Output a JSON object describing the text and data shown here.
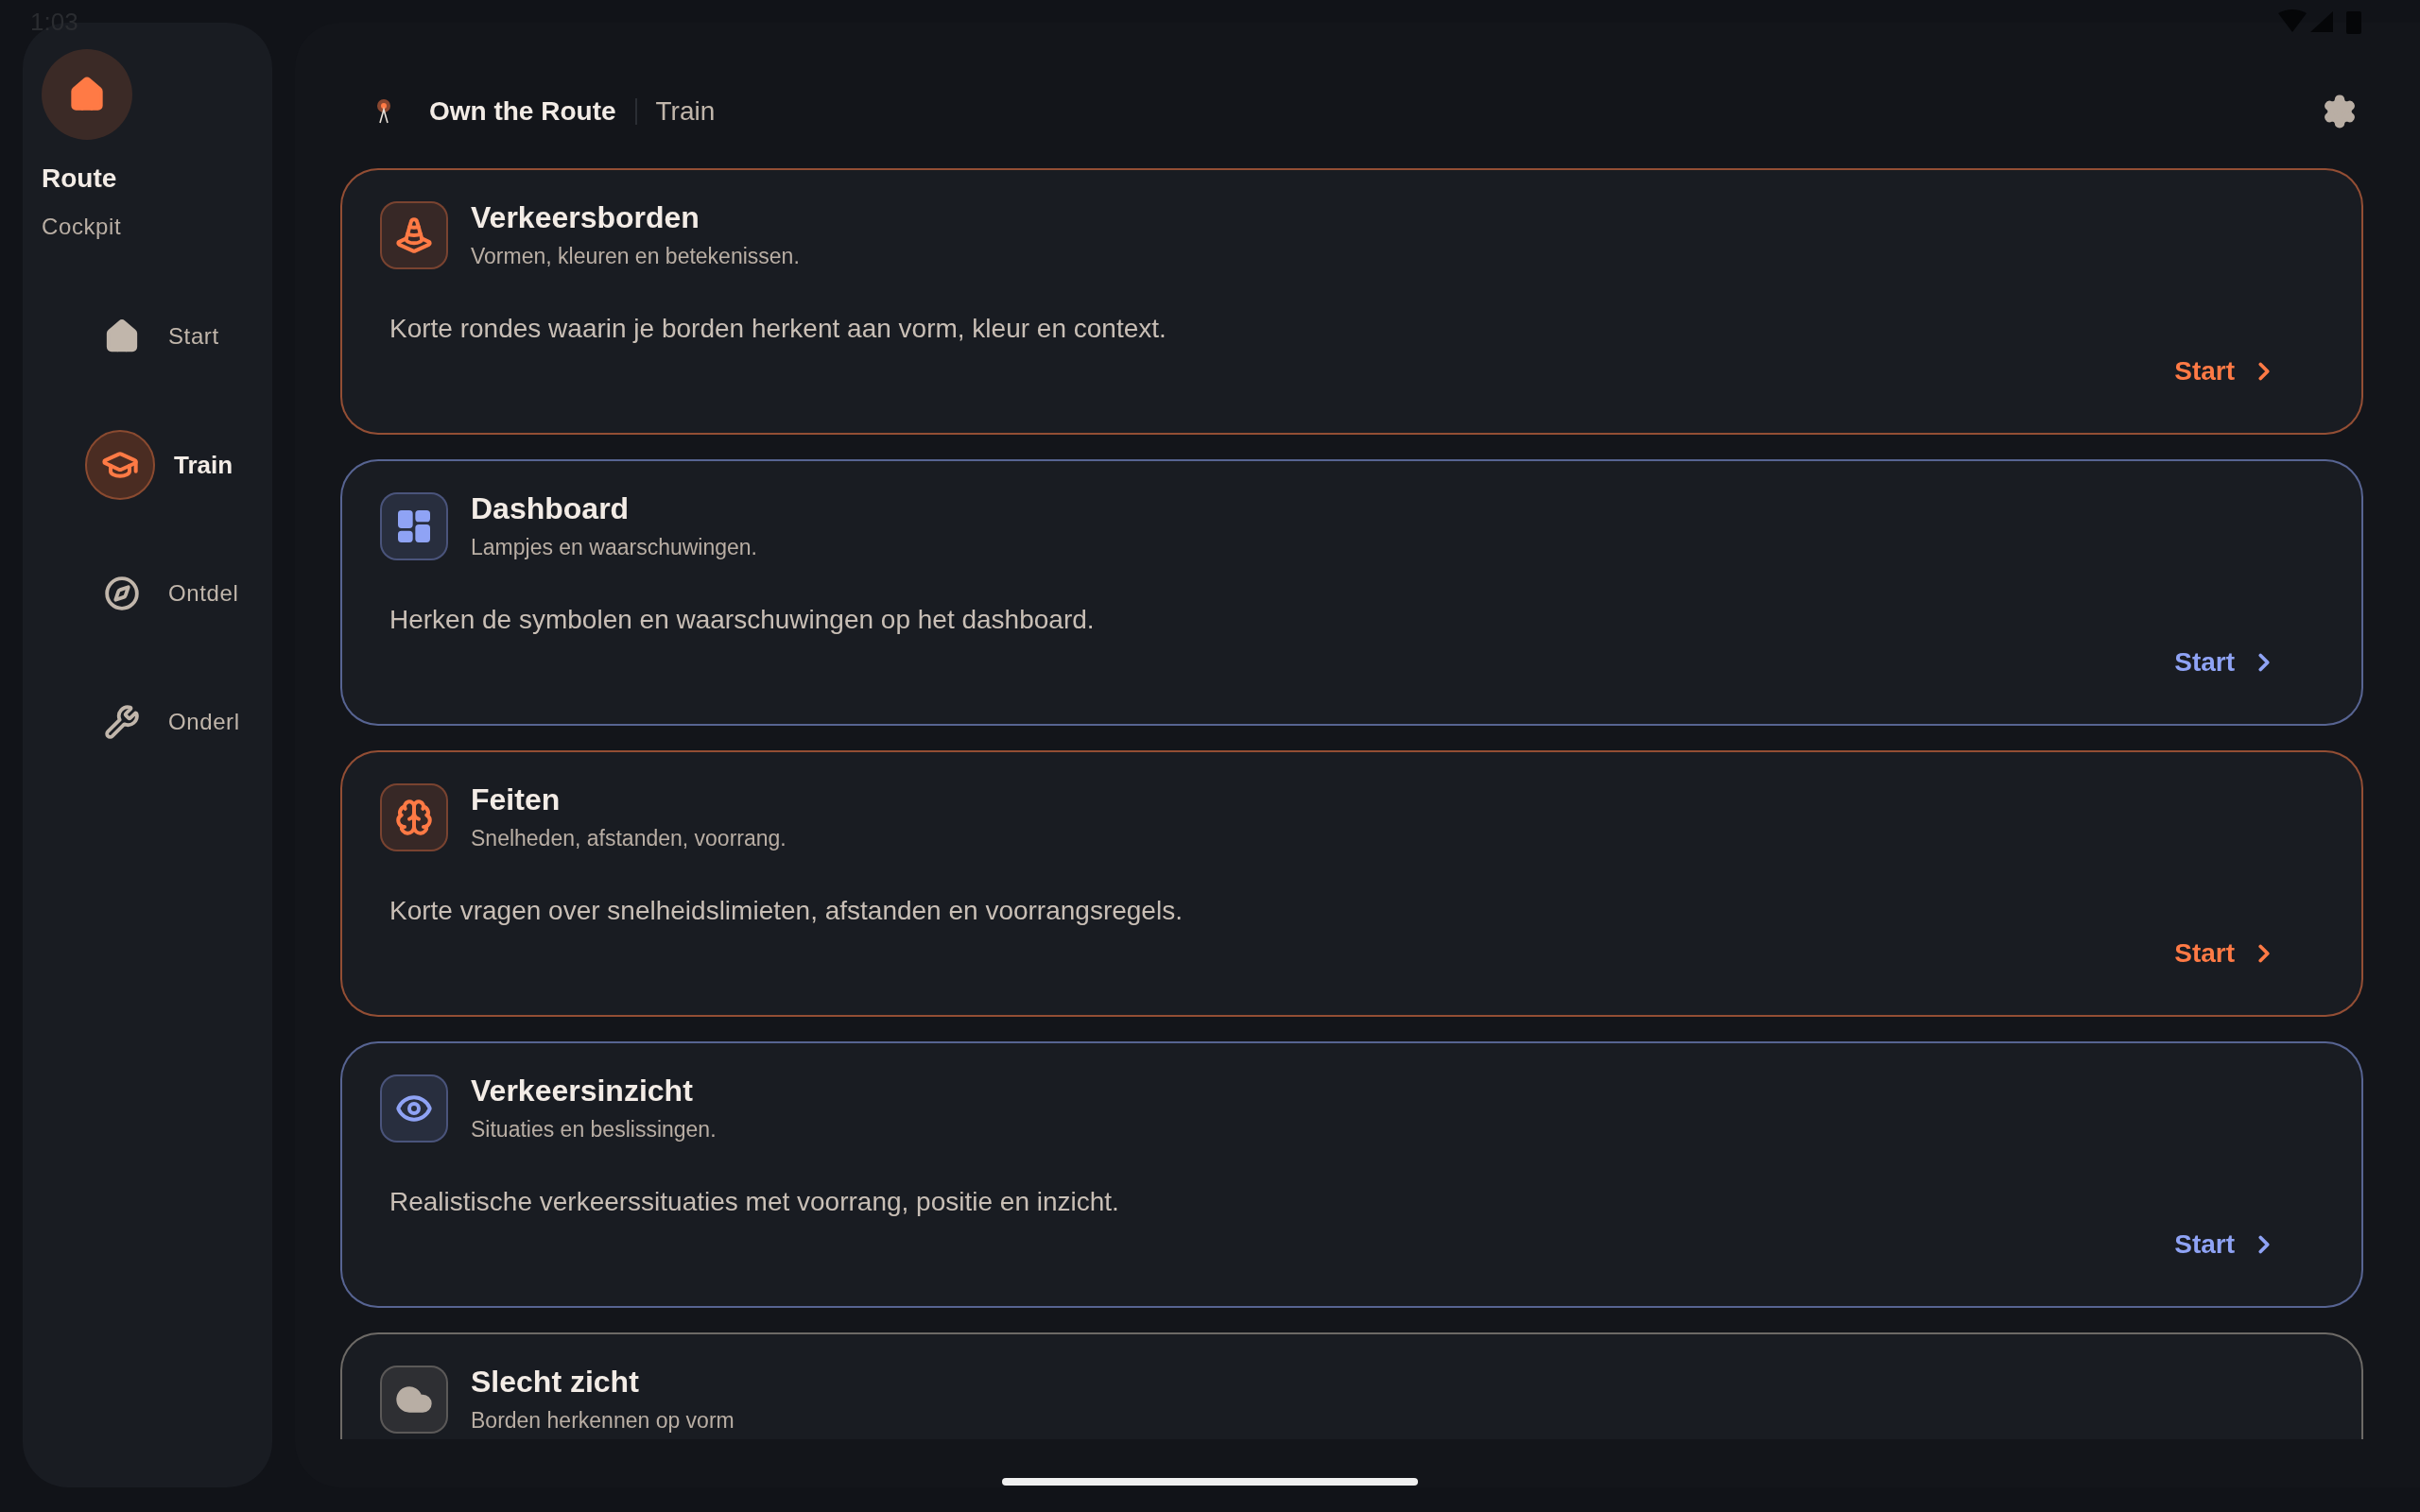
{
  "status_bar": {
    "time": "1:03"
  },
  "sidebar": {
    "title": "Route",
    "subtitle": "Cockpit",
    "items": [
      {
        "label": "Start",
        "selected": false
      },
      {
        "label": "Train",
        "selected": true
      },
      {
        "label": "Ontdel",
        "selected": false
      },
      {
        "label": "Onderl",
        "selected": false
      }
    ]
  },
  "header": {
    "app_name": "Own the Route",
    "section": "Train"
  },
  "cards": [
    {
      "title": "Verkeersborden",
      "subtitle": "Vormen, kleuren en betekenissen.",
      "description": "Korte rondes waarin je borden herkent aan vorm, kleur en context.",
      "action": "Start",
      "color": "#ff7a45"
    },
    {
      "title": "Dashboard",
      "subtitle": "Lampjes en waarschuwingen.",
      "description": "Herken de symbolen en waarschuwingen op het dashboard.",
      "action": "Start",
      "color": "#8fa3f5"
    },
    {
      "title": "Feiten",
      "subtitle": "Snelheden, afstanden, voorrang.",
      "description": "Korte vragen over snelheidslimieten, afstanden en voorrangsregels.",
      "action": "Start",
      "color": "#ff7a45"
    },
    {
      "title": "Verkeersinzicht",
      "subtitle": "Situaties en beslissingen.",
      "description": "Realistische verkeerssituaties met voorrang, positie en inzicht.",
      "action": "Start",
      "color": "#8fa3f5"
    },
    {
      "title": "Slecht zicht",
      "subtitle": "Borden herkennen op vorm",
      "color": "#b8aea4"
    }
  ]
}
